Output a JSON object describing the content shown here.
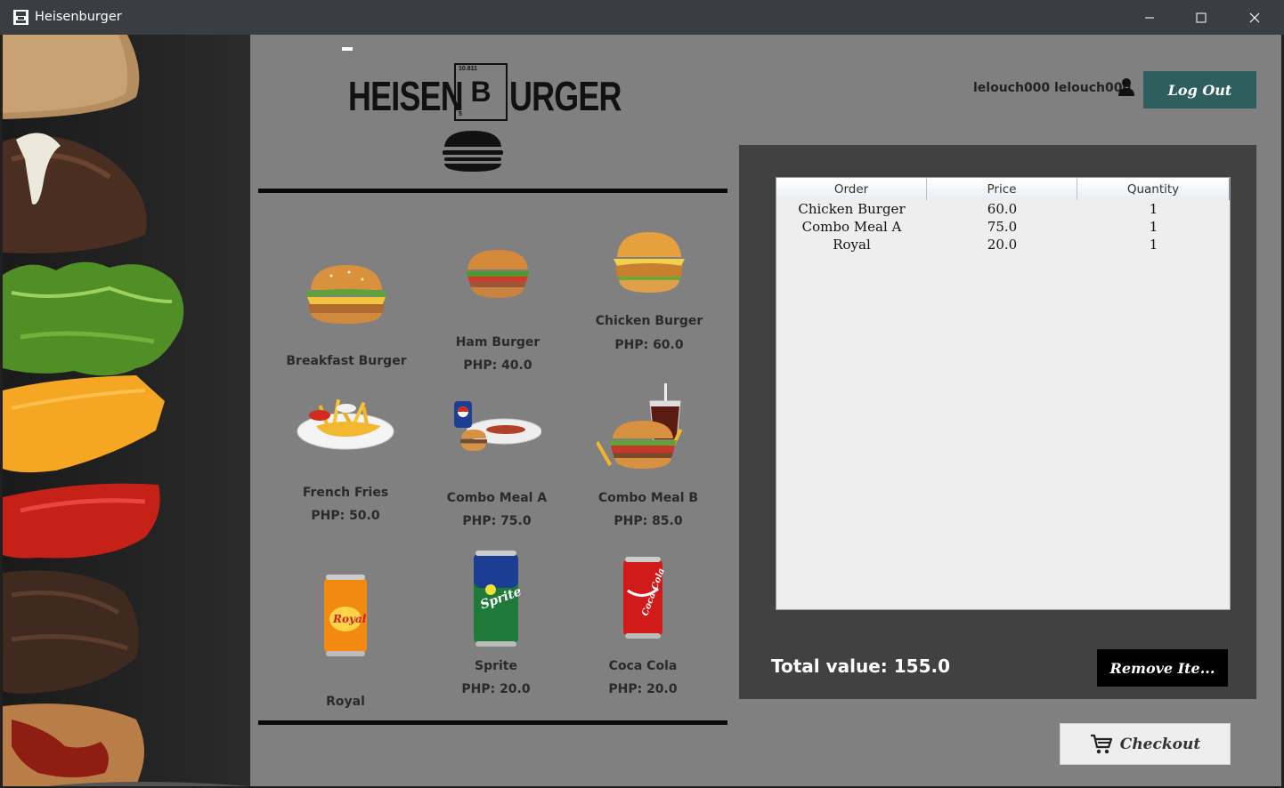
{
  "window": {
    "title": "Heisenburger",
    "minimize": "—",
    "maximize": "☐",
    "close": "✕"
  },
  "logo": {
    "left_text": "HEISEN",
    "box_letter": "B",
    "box_number": "10.811",
    "box_sub": "5",
    "right_text": "URGER"
  },
  "user": {
    "name": "lelouch000 lelouch000",
    "logout_label": "Log Out"
  },
  "menu": [
    {
      "name": "Breakfast Burger",
      "price": ""
    },
    {
      "name": "Ham Burger",
      "price": "PHP: 40.0"
    },
    {
      "name": "Chicken Burger",
      "price": "PHP: 60.0"
    },
    {
      "name": "French Fries",
      "price": "PHP: 50.0"
    },
    {
      "name": "Combo Meal A",
      "price": "PHP: 75.0"
    },
    {
      "name": "Combo Meal B",
      "price": "PHP: 85.0"
    },
    {
      "name": "Royal",
      "price": ""
    },
    {
      "name": "Sprite",
      "price": "PHP: 20.0"
    },
    {
      "name": "Coca Cola",
      "price": "PHP: 20.0"
    }
  ],
  "order_table": {
    "columns": [
      "Order",
      "Price",
      "Quantity"
    ],
    "rows": [
      [
        "Chicken Burger",
        "60.0",
        "1"
      ],
      [
        "Combo Meal A",
        "75.0",
        "1"
      ],
      [
        "Royal",
        "20.0",
        "1"
      ]
    ]
  },
  "total_label": "Total value: 155.0",
  "remove_label": "Remove Ite...",
  "checkout_label": "Checkout",
  "colors": {
    "titlebar": "#3a3d41",
    "main_bg": "#808080",
    "order_panel": "#414141",
    "logout_bg": "#2e5f5e",
    "remove_bg": "#000000"
  }
}
